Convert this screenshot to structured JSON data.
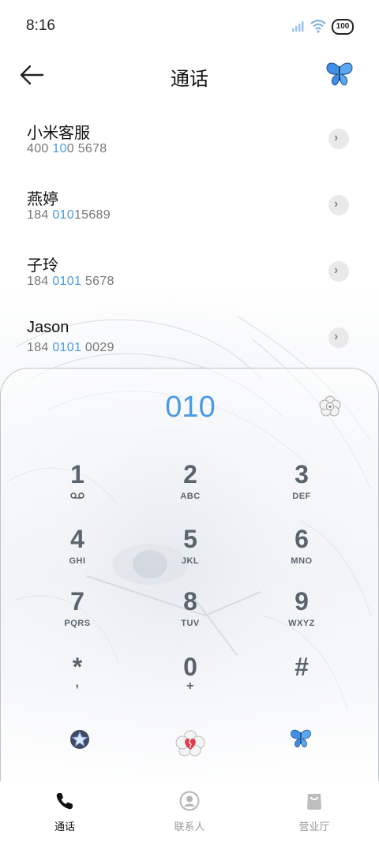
{
  "status_bar": {
    "time": "8:16",
    "battery": "100"
  },
  "header": {
    "title": "通话"
  },
  "contacts": [
    {
      "name": "小米客服",
      "number_parts": [
        "400 ",
        "10",
        "0 5678"
      ]
    },
    {
      "name": "燕婷",
      "number_parts": [
        "184 ",
        "010",
        "15689"
      ]
    },
    {
      "name": "子玲",
      "number_parts": [
        "184 ",
        "0101",
        " 5678"
      ]
    },
    {
      "name": "Jason",
      "number_parts": [
        "184 ",
        "0101",
        " 0029"
      ]
    }
  ],
  "dialer": {
    "entry": "010",
    "keys": [
      {
        "digit": "1",
        "letters": ""
      },
      {
        "digit": "2",
        "letters": "ABC"
      },
      {
        "digit": "3",
        "letters": "DEF"
      },
      {
        "digit": "4",
        "letters": "GHI"
      },
      {
        "digit": "5",
        "letters": "JKL"
      },
      {
        "digit": "6",
        "letters": "MNO"
      },
      {
        "digit": "7",
        "letters": "PQRS"
      },
      {
        "digit": "8",
        "letters": "TUV"
      },
      {
        "digit": "9",
        "letters": "WXYZ"
      },
      {
        "digit": "*",
        "letters": ","
      },
      {
        "digit": "0",
        "letters": "+"
      },
      {
        "digit": "#",
        "letters": ""
      }
    ]
  },
  "bottom_nav": {
    "tabs": [
      {
        "label": "通话",
        "active": true
      },
      {
        "label": "联系人",
        "active": false
      },
      {
        "label": "营业厅",
        "active": false
      }
    ]
  },
  "colors": {
    "accent": "#4a9be4",
    "key_text": "#5a646d"
  },
  "icons": [
    "back-arrow-icon",
    "butterfly-icon",
    "chevron-right-icon",
    "voicemail-icon",
    "flower-clear-icon",
    "star-icon",
    "heart-call-icon",
    "phone-icon",
    "person-icon",
    "shop-icon"
  ]
}
